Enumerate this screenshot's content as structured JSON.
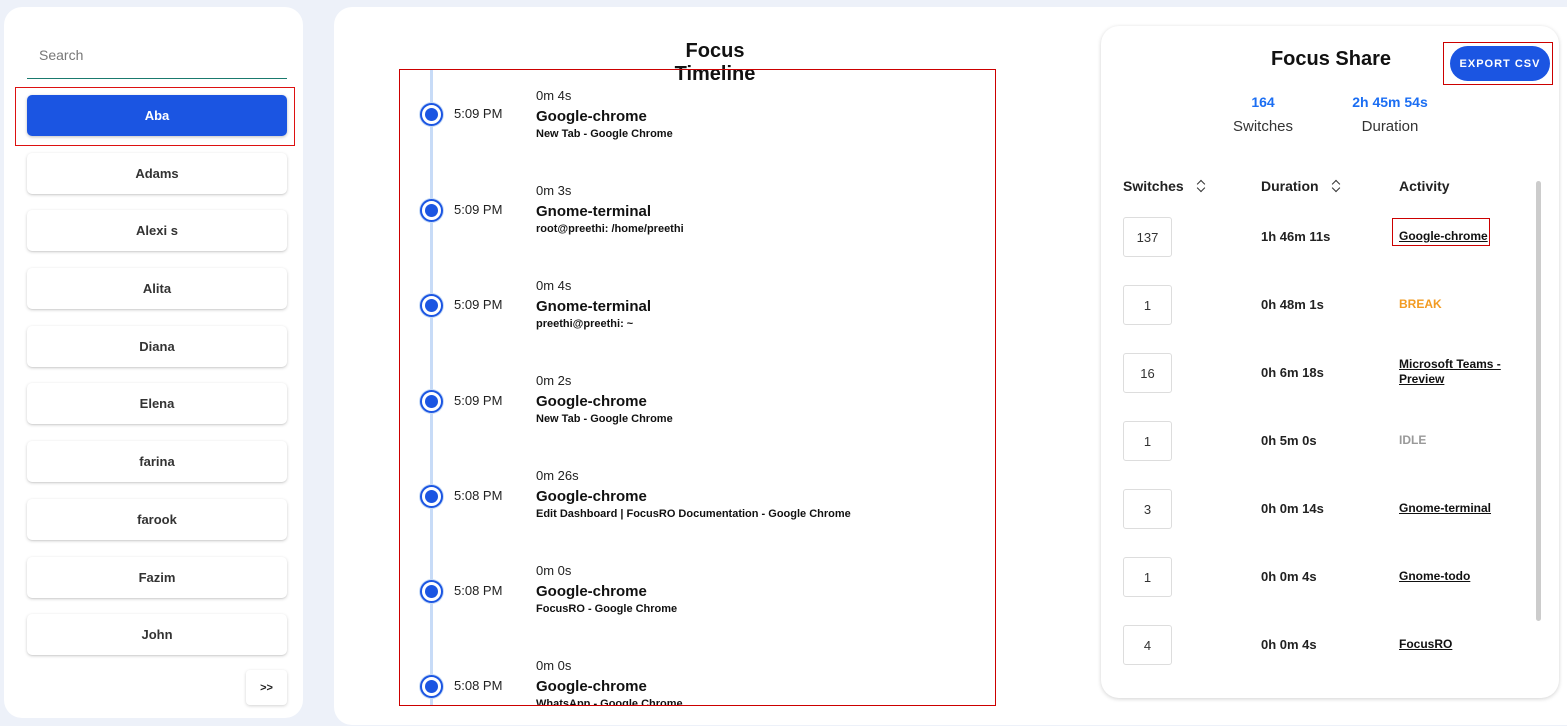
{
  "sidebar": {
    "search_placeholder": "Search",
    "users": [
      "Aba",
      "Adams",
      "Alexi s",
      "Alita",
      "Diana",
      "Elena",
      "farina",
      "farook",
      "Fazim",
      "John"
    ],
    "next_label": ">>"
  },
  "timeline": {
    "title": "Focus Timeline",
    "entries": [
      {
        "time": "5:09 PM",
        "duration": "0m 4s",
        "app": "Google-chrome",
        "window": "New Tab - Google Chrome"
      },
      {
        "time": "5:09 PM",
        "duration": "0m 3s",
        "app": "Gnome-terminal",
        "window": "root@preethi: /home/preethi"
      },
      {
        "time": "5:09 PM",
        "duration": "0m 4s",
        "app": "Gnome-terminal",
        "window": "preethi@preethi: ~"
      },
      {
        "time": "5:09 PM",
        "duration": "0m 2s",
        "app": "Google-chrome",
        "window": "New Tab - Google Chrome"
      },
      {
        "time": "5:08 PM",
        "duration": "0m 26s",
        "app": "Google-chrome",
        "window": "Edit Dashboard | FocusRO Documentation - Google Chrome"
      },
      {
        "time": "5:08 PM",
        "duration": "0m 0s",
        "app": "Google-chrome",
        "window": "FocusRO - Google Chrome"
      },
      {
        "time": "5:08 PM",
        "duration": "0m 0s",
        "app": "Google-chrome",
        "window": "WhatsApp - Google Chrome"
      }
    ]
  },
  "share": {
    "title": "Focus Share",
    "export_label": "EXPORT CSV",
    "switches_value": "164",
    "switches_label": "Switches",
    "duration_value": "2h 45m 54s",
    "duration_label": "Duration",
    "columns": {
      "switches": "Switches",
      "duration": "Duration",
      "activity": "Activity"
    },
    "rows": [
      {
        "switches": "137",
        "duration": "1h 46m 11s",
        "activity": "Google-chrome",
        "kind": "link"
      },
      {
        "switches": "1",
        "duration": "0h 48m 1s",
        "activity": "BREAK",
        "kind": "break"
      },
      {
        "switches": "16",
        "duration": "0h 6m 18s",
        "activity": "Microsoft Teams - Preview",
        "kind": "link"
      },
      {
        "switches": "1",
        "duration": "0h 5m 0s",
        "activity": "IDLE",
        "kind": "idle"
      },
      {
        "switches": "3",
        "duration": "0h 0m 14s",
        "activity": "Gnome-terminal",
        "kind": "link"
      },
      {
        "switches": "1",
        "duration": "0h 0m 4s",
        "activity": "Gnome-todo",
        "kind": "link"
      },
      {
        "switches": "4",
        "duration": "0h 0m 4s",
        "activity": "FocusRO",
        "kind": "link"
      }
    ]
  },
  "colors": {
    "accent": "#1b55e2",
    "break": "#f29b22",
    "idle": "#999999",
    "highlight_outline": "#cc0000"
  }
}
